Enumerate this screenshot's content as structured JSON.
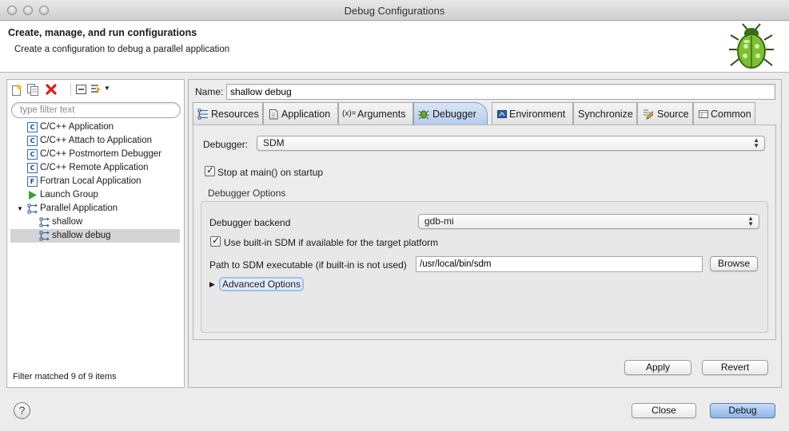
{
  "window": {
    "title": "Debug Configurations"
  },
  "header": {
    "title": "Create, manage, and run configurations",
    "subtitle": "Create a configuration to debug a parallel application"
  },
  "left": {
    "filter_placeholder": "type filter text",
    "tree": [
      {
        "label": "C/C++ Application",
        "icon": "c-app-icon"
      },
      {
        "label": "C/C++ Attach to Application",
        "icon": "c-app-icon"
      },
      {
        "label": "C/C++ Postmortem Debugger",
        "icon": "c-app-icon"
      },
      {
        "label": "C/C++ Remote Application",
        "icon": "c-app-icon"
      },
      {
        "label": "Fortran Local Application",
        "icon": "fortran-icon"
      },
      {
        "label": "Launch Group",
        "icon": "launch-group-icon"
      },
      {
        "label": "Parallel Application",
        "icon": "parallel-app-icon",
        "expanded": true
      },
      {
        "label": "shallow",
        "icon": "parallel-config-icon",
        "child": true
      },
      {
        "label": "shallow debug",
        "icon": "parallel-config-icon",
        "child": true,
        "selected": true
      }
    ],
    "status": "Filter matched 9 of 9 items"
  },
  "right": {
    "name_label": "Name:",
    "name_value": "shallow debug",
    "tabs": [
      {
        "label": "Resources",
        "icon": "resources-icon"
      },
      {
        "label": "Application",
        "icon": "application-icon"
      },
      {
        "label": "Arguments",
        "icon": "arguments-icon",
        "icon_text": "(x)="
      },
      {
        "label": "Debugger",
        "icon": "debugger-bug-icon",
        "active": true
      },
      {
        "label": "Environment",
        "icon": "environment-icon"
      },
      {
        "label": "Synchronize",
        "icon": ""
      },
      {
        "label": "Source",
        "icon": "source-icon"
      },
      {
        "label": "Common",
        "icon": "common-icon"
      }
    ],
    "debugger_label": "Debugger:",
    "debugger_value": "SDM",
    "stop_at_main": {
      "label": "Stop at main() on startup",
      "checked": true
    },
    "options_title": "Debugger Options",
    "backend_label": "Debugger backend",
    "backend_value": "gdb-mi",
    "use_builtin": {
      "label": "Use built-in SDM if available for the target platform",
      "checked": true
    },
    "path_label": "Path to SDM executable (if built-in is not used)",
    "path_value": "/usr/local/bin/sdm",
    "browse_label": "Browse",
    "advanced_label": "Advanced Options",
    "apply_label": "Apply",
    "revert_label": "Revert"
  },
  "footer": {
    "help_symbol": "?",
    "close_label": "Close",
    "debug_label": "Debug"
  }
}
